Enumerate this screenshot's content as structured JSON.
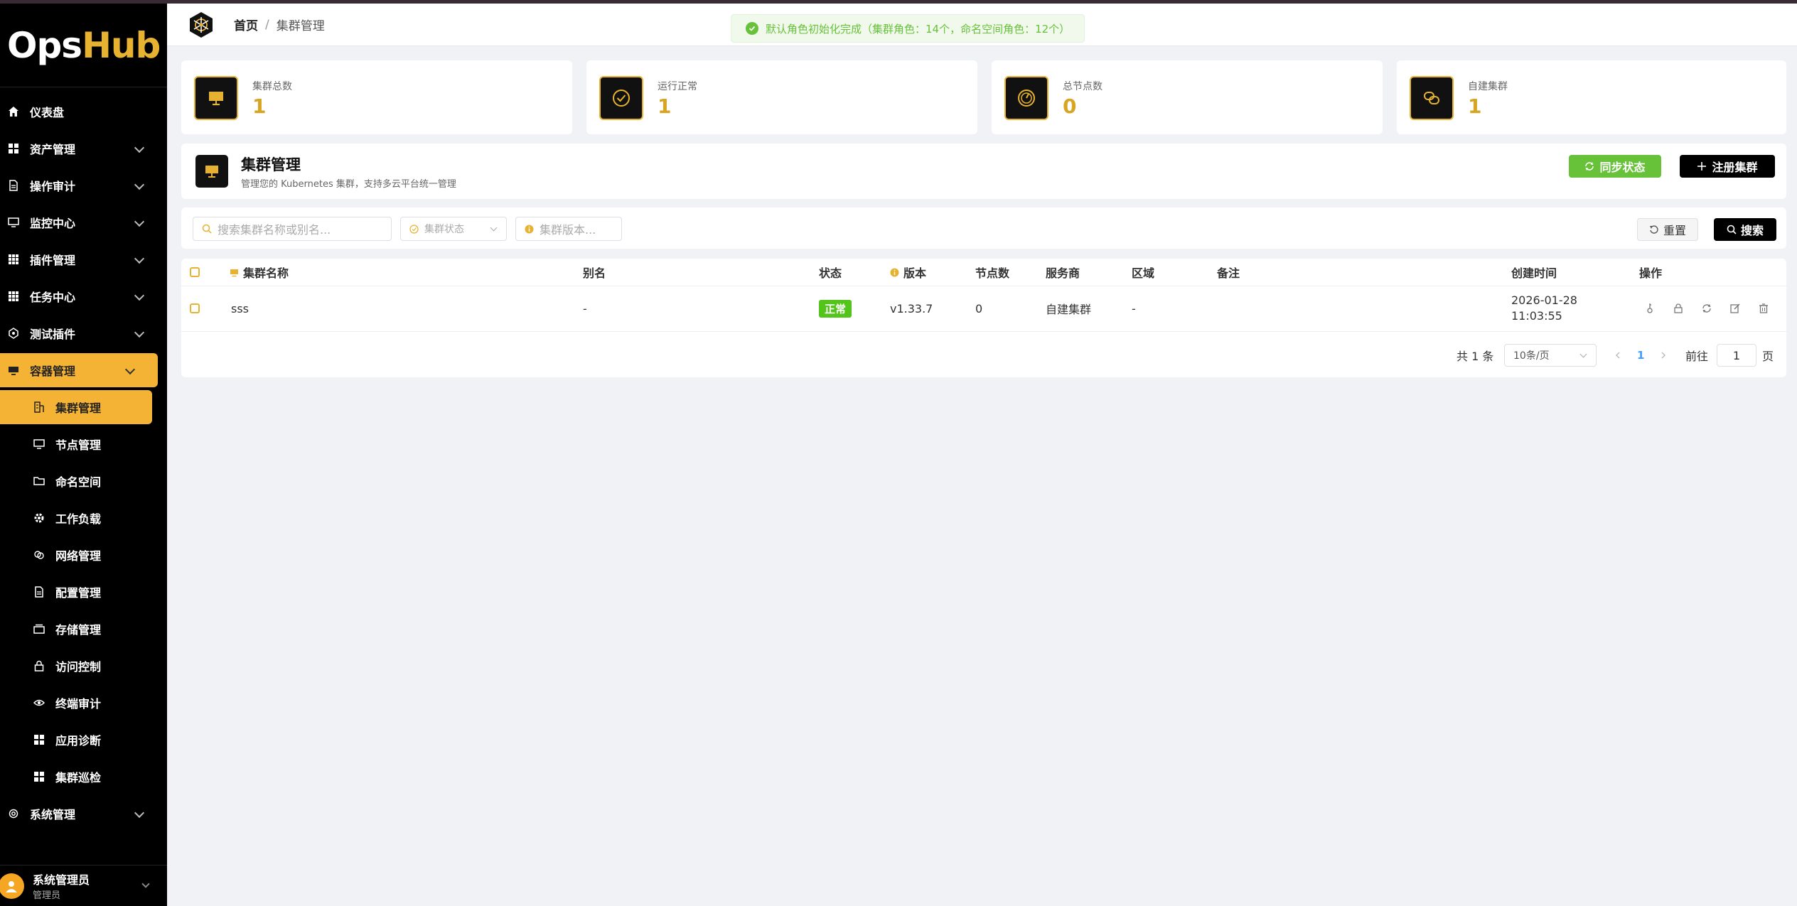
{
  "app": {
    "logo_ops": "Ops",
    "logo_hub": "Hub"
  },
  "sidebar": {
    "items": [
      {
        "label": "仪表盘",
        "icon": "home-icon"
      },
      {
        "label": "资产管理",
        "icon": "grid-icon"
      },
      {
        "label": "操作审计",
        "icon": "document-icon"
      },
      {
        "label": "监控中心",
        "icon": "monitor-icon"
      },
      {
        "label": "插件管理",
        "icon": "apps-icon"
      },
      {
        "label": "任务中心",
        "icon": "apps-icon"
      },
      {
        "label": "测试插件",
        "icon": "plugin-icon"
      },
      {
        "label": "容器管理",
        "icon": "container-icon"
      },
      {
        "label": "系统管理",
        "icon": "gear-icon"
      }
    ],
    "sub_items": [
      {
        "label": "集群管理",
        "icon": "cluster-icon"
      },
      {
        "label": "节点管理",
        "icon": "monitor-icon"
      },
      {
        "label": "命名空间",
        "icon": "folder-icon"
      },
      {
        "label": "工作负载",
        "icon": "gear-icon"
      },
      {
        "label": "网络管理",
        "icon": "network-icon"
      },
      {
        "label": "配置管理",
        "icon": "document-icon"
      },
      {
        "label": "存储管理",
        "icon": "storage-icon"
      },
      {
        "label": "访问控制",
        "icon": "lock-icon"
      },
      {
        "label": "终端审计",
        "icon": "eye-icon"
      },
      {
        "label": "应用诊断",
        "icon": "apps-icon"
      },
      {
        "label": "集群巡检",
        "icon": "apps-icon"
      }
    ],
    "user": {
      "name": "系统管理员",
      "role": "管理员"
    }
  },
  "header": {
    "breadcrumb_home": "首页",
    "breadcrumb_sep": "/",
    "breadcrumb_current": "集群管理",
    "toast": "默认角色初始化完成（集群角色：14个，命名空间角色：12个）"
  },
  "stats": [
    {
      "label": "集群总数",
      "value": "1",
      "icon": "monitor-icon"
    },
    {
      "label": "运行正常",
      "value": "1",
      "icon": "check-circle-icon"
    },
    {
      "label": "总节点数",
      "value": "0",
      "icon": "gauge-icon"
    },
    {
      "label": "自建集群",
      "value": "1",
      "icon": "link-icon"
    }
  ],
  "page": {
    "title": "集群管理",
    "subtitle": "管理您的 Kubernetes 集群，支持多云平台统一管理",
    "sync_label": "同步状态",
    "register_label": "注册集群"
  },
  "filters": {
    "search_placeholder": "搜索集群名称或别名...",
    "status_placeholder": "集群状态",
    "version_placeholder": "集群版本...",
    "reset_label": "重置",
    "search_label": "搜索"
  },
  "table": {
    "columns": [
      "集群名称",
      "别名",
      "状态",
      "版本",
      "节点数",
      "服务商",
      "区域",
      "备注",
      "创建时间",
      "操作"
    ],
    "rows": [
      {
        "name": "sss",
        "alias": "-",
        "status": "正常",
        "version": "v1.33.7",
        "nodes": "0",
        "provider": "自建集群",
        "region": "-",
        "remark": "",
        "created_date": "2026-01-28",
        "created_time": "11:03:55"
      }
    ]
  },
  "pagination": {
    "total": "共 1 条",
    "page_size": "10条/页",
    "current": "1",
    "goto_prefix": "前往",
    "goto_value": "1",
    "goto_suffix": "页"
  },
  "colors": {
    "accent": "#f5b335",
    "gold": "#d9a520",
    "success": "#67c23a",
    "dark": "#000000"
  }
}
